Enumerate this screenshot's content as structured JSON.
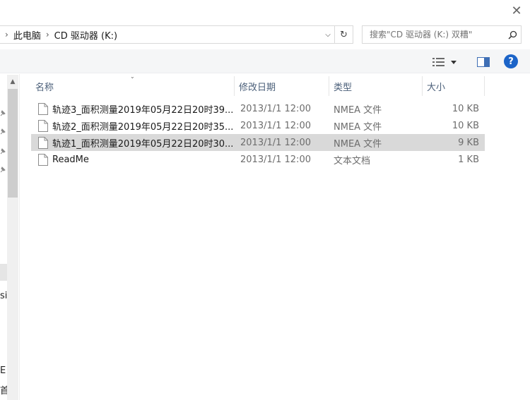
{
  "window": {
    "close_glyph": "✕"
  },
  "address": {
    "sep1": "›",
    "crumb1": "此电脑",
    "sep2": "›",
    "crumb2": "CD 驱动器 (K:)",
    "dropdown_glyph": "⌵",
    "refresh_glyph": "↻"
  },
  "search": {
    "placeholder": "搜索\"CD 驱动器 (K:) 双糟\""
  },
  "toolbar": {
    "help_label": "?"
  },
  "columns": {
    "name": "名称",
    "date": "修改日期",
    "type": "类型",
    "size": "大小",
    "sort_glyph": "⌄"
  },
  "files": [
    {
      "name": "轨迹3_面积测量2019年05月22日20时39...",
      "date": "2013/1/1 12:00",
      "type": "NMEA 文件",
      "size": "10 KB",
      "selected": false
    },
    {
      "name": "轨迹2_面积测量2019年05月22日20时35...",
      "date": "2013/1/1 12:00",
      "type": "NMEA 文件",
      "size": "10 KB",
      "selected": false
    },
    {
      "name": "轨迹1_面积测量2019年05月22日20时30...",
      "date": "2013/1/1 12:00",
      "type": "NMEA 文件",
      "size": "9 KB",
      "selected": true
    },
    {
      "name": "ReadMe",
      "date": "2013/1/1 12:00",
      "type": "文本文档",
      "size": "1 KB",
      "selected": false
    }
  ],
  "navpane": {
    "scroll_up_glyph": "▲",
    "text1": "si",
    "text2": "E",
    "text3": "首"
  },
  "colors": {
    "accent": "#1c64c8",
    "header_text": "#4c607a",
    "selected_row": "#d9d9d9"
  }
}
